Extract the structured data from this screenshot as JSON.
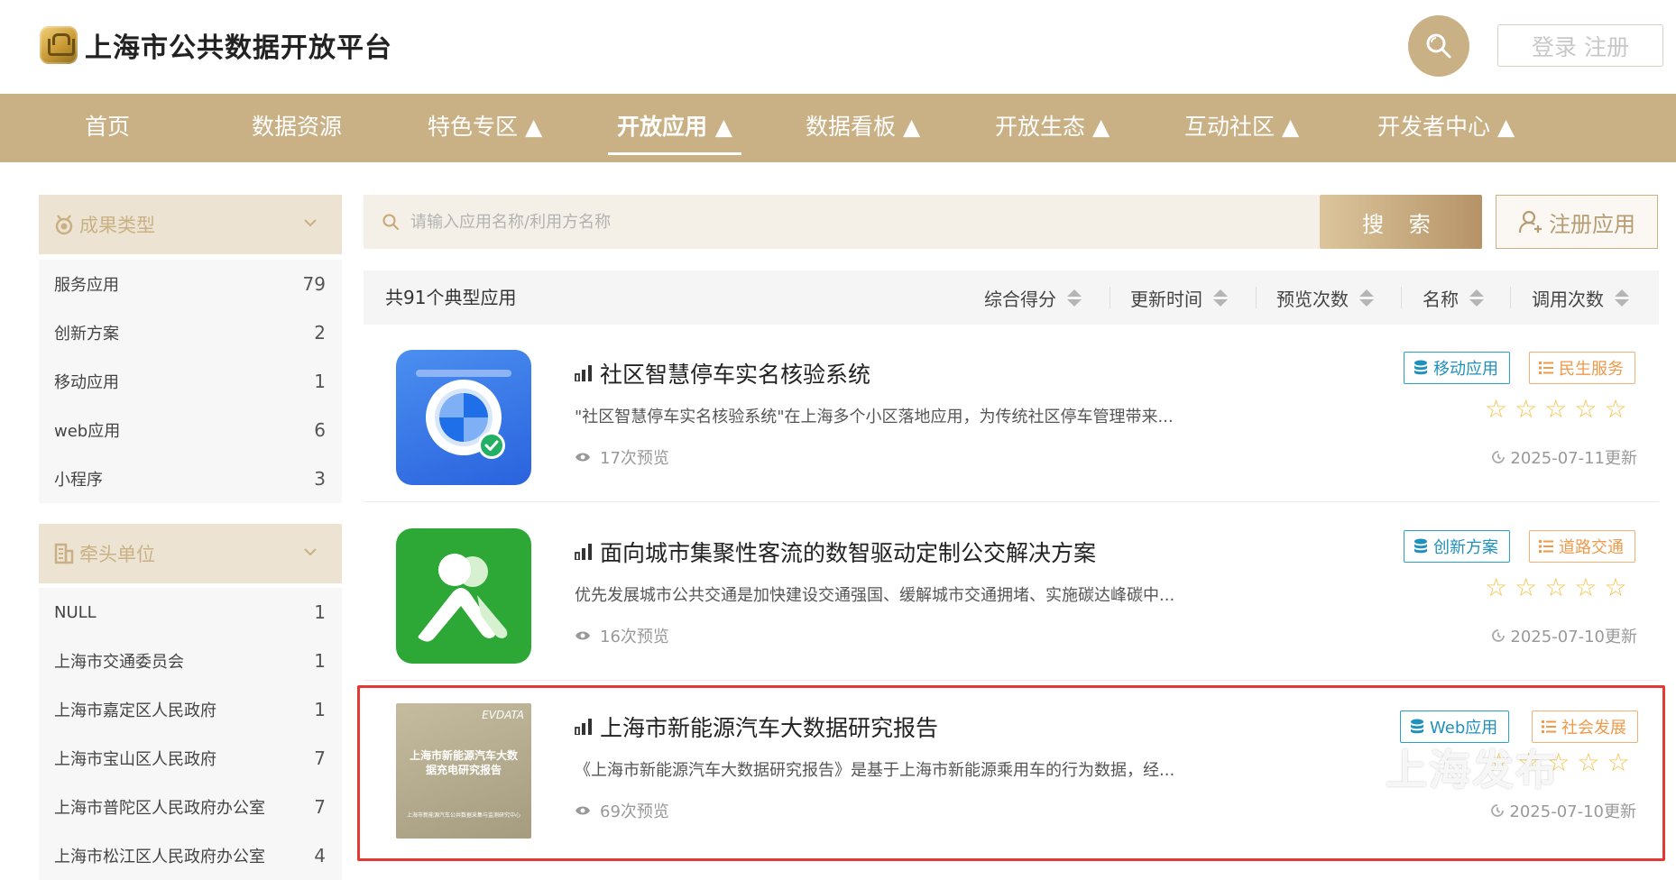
{
  "header": {
    "site_title": "上海市公共数据开放平台",
    "login_label": "登录",
    "register_label": "注册"
  },
  "nav": {
    "items": [
      {
        "label": "首页"
      },
      {
        "label": "数据资源"
      },
      {
        "label": "特色专区 ▲"
      },
      {
        "label": "开放应用 ▲",
        "active": true
      },
      {
        "label": "数据看板 ▲"
      },
      {
        "label": "开放生态 ▲"
      },
      {
        "label": "互动社区 ▲"
      },
      {
        "label": "开发者中心 ▲"
      }
    ]
  },
  "sidebar": {
    "result_type": {
      "title": "成果类型",
      "items": [
        {
          "label": "服务应用",
          "count": "79"
        },
        {
          "label": "创新方案",
          "count": "2"
        },
        {
          "label": "移动应用",
          "count": "1"
        },
        {
          "label": "web应用",
          "count": "6"
        },
        {
          "label": "小程序",
          "count": "3"
        }
      ]
    },
    "lead_unit": {
      "title": "牵头单位",
      "items": [
        {
          "label": "NULL",
          "count": "1"
        },
        {
          "label": "上海市交通委员会",
          "count": "1"
        },
        {
          "label": "上海市嘉定区人民政府",
          "count": "1"
        },
        {
          "label": "上海市宝山区人民政府",
          "count": "7"
        },
        {
          "label": "上海市普陀区人民政府办公室",
          "count": "7"
        },
        {
          "label": "上海市松江区人民政府办公室",
          "count": "4"
        }
      ]
    }
  },
  "search": {
    "placeholder": "请输入应用名称/利用方名称",
    "button_label": "搜 索",
    "register_app_label": "注册应用"
  },
  "list": {
    "total_text": "共91个典型应用",
    "sort_options": [
      "综合得分",
      "更新时间",
      "预览次数",
      "名称",
      "调用次数"
    ]
  },
  "apps": [
    {
      "title": "社区智慧停车实名核验系统",
      "description": "\"社区智慧停车实名核验系统\"在上海多个小区落地应用，为传统社区停车管理带来...",
      "views": "17次预览",
      "type_tag": "移动应用",
      "domain_tag": "民生服务",
      "rating": 0,
      "updated": "2025-07-11更新"
    },
    {
      "title": "面向城市集聚性客流的数智驱动定制公交解决方案",
      "description": "优先发展城市公共交通是加快建设交通强国、缓解城市交通拥堵、实施碳达峰碳中...",
      "views": "16次预览",
      "type_tag": "创新方案",
      "domain_tag": "道路交通",
      "rating": 0,
      "updated": "2025-07-10更新"
    },
    {
      "title": "上海市新能源汽车大数据研究报告",
      "description": "《上海市新能源汽车大数据研究报告》是基于上海市新能源乘用车的行为数据，经...",
      "views": "69次预览",
      "type_tag": "Web应用",
      "domain_tag": "社会发展",
      "rating": 0,
      "updated": "2025-07-10更新",
      "thumb_brand": "EVDATA",
      "thumb_title": "上海市新能源汽车大数据充电研究报告",
      "thumb_footer": "上海市新能源汽车公共数据采集与监测研究中心"
    }
  ],
  "watermark": "上海发布",
  "colors": {
    "brand_gold": "#c9b185",
    "sidebar_header_bg": "#ede3d2",
    "tag_blue": "#2090bd",
    "tag_orange": "#ee9a4a",
    "highlight_red": "#e23a32",
    "star": "#f3c34a"
  },
  "icons": {
    "search": "magnifier-icon",
    "medal": "medal-icon",
    "building": "building-icon",
    "user_add": "user-add-icon",
    "bars": "signal-bars-icon",
    "eye": "eye-icon",
    "database": "database-icon",
    "list": "list-icon",
    "star": "star-outline-icon",
    "clock": "clock-icon",
    "chevron": "chevron-down-icon"
  }
}
